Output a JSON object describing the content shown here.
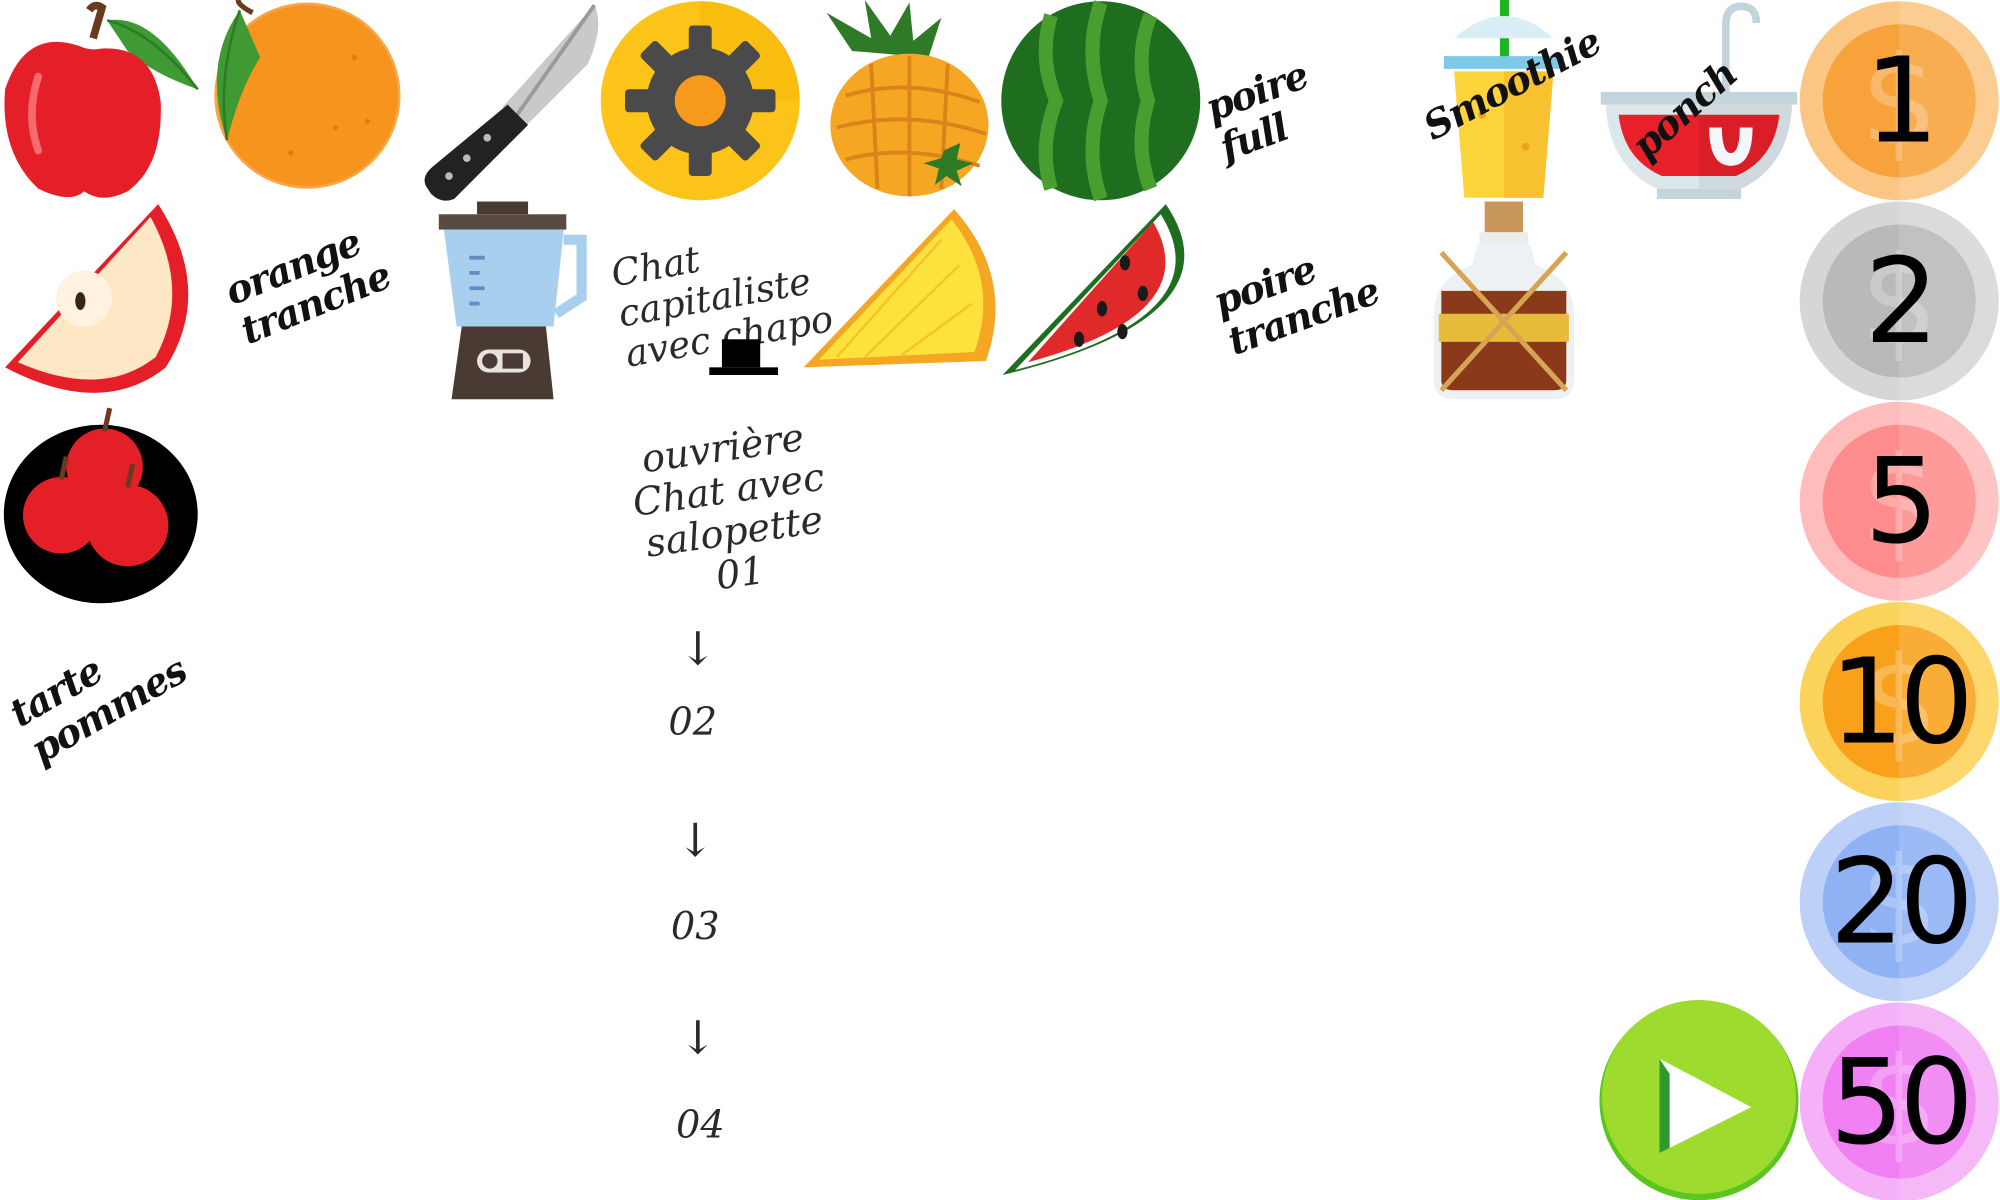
{
  "sprites": {
    "apple": "apple-icon",
    "orange": "orange-icon",
    "knife": "knife-icon",
    "settings": "gear-icon",
    "pineapple": "pineapple-icon",
    "watermelon": "watermelon-icon",
    "smoothie": "smoothie-cup-icon",
    "punch_bowl": "punch-bowl-icon",
    "apple_slice": "apple-slice-icon",
    "blender": "blender-icon",
    "pineapple_slice": "pineapple-slice-icon",
    "watermelon_slice": "watermelon-slice-icon",
    "rum_bottle": "rum-bottle-icon",
    "apple_pile": "apple-pile-icon",
    "play": "play-icon"
  },
  "notes": {
    "orange_sliced": "orange\ntranche",
    "pear_full": "poire\nfull",
    "smoothie": "Smoothie",
    "punch": "ponch",
    "cat_capitalist": "Chat\ncapitaliste\navec chapo",
    "pear_sliced": "poire\ntranche",
    "worker_cat": "ouvrière\nChat avec\nsalopette\n01",
    "apple_pie": "tarte\npommes",
    "arrow_1": "↓",
    "frame_02": "02",
    "arrow_2": "↓",
    "frame_03": "03",
    "arrow_3": "↓",
    "frame_04": "04"
  },
  "coins": [
    {
      "value": "1",
      "color": "#f7a23a",
      "rim": "#fbc683"
    },
    {
      "value": "2",
      "color": "#b9b9b9",
      "rim": "#d6d6d6"
    },
    {
      "value": "5",
      "color": "#ff8c8c",
      "rim": "#ffbcbc"
    },
    {
      "value": "10",
      "color": "#f9a11b",
      "rim": "#fcd35a"
    },
    {
      "value": "20",
      "color": "#8fb2f5",
      "rim": "#bcd0f8"
    },
    {
      "value": "50",
      "color": "#f07ff3",
      "rim": "#f5b0f7"
    }
  ],
  "colors": {
    "play_green": "#8ed11e",
    "play_green_light": "#a8e03a"
  }
}
